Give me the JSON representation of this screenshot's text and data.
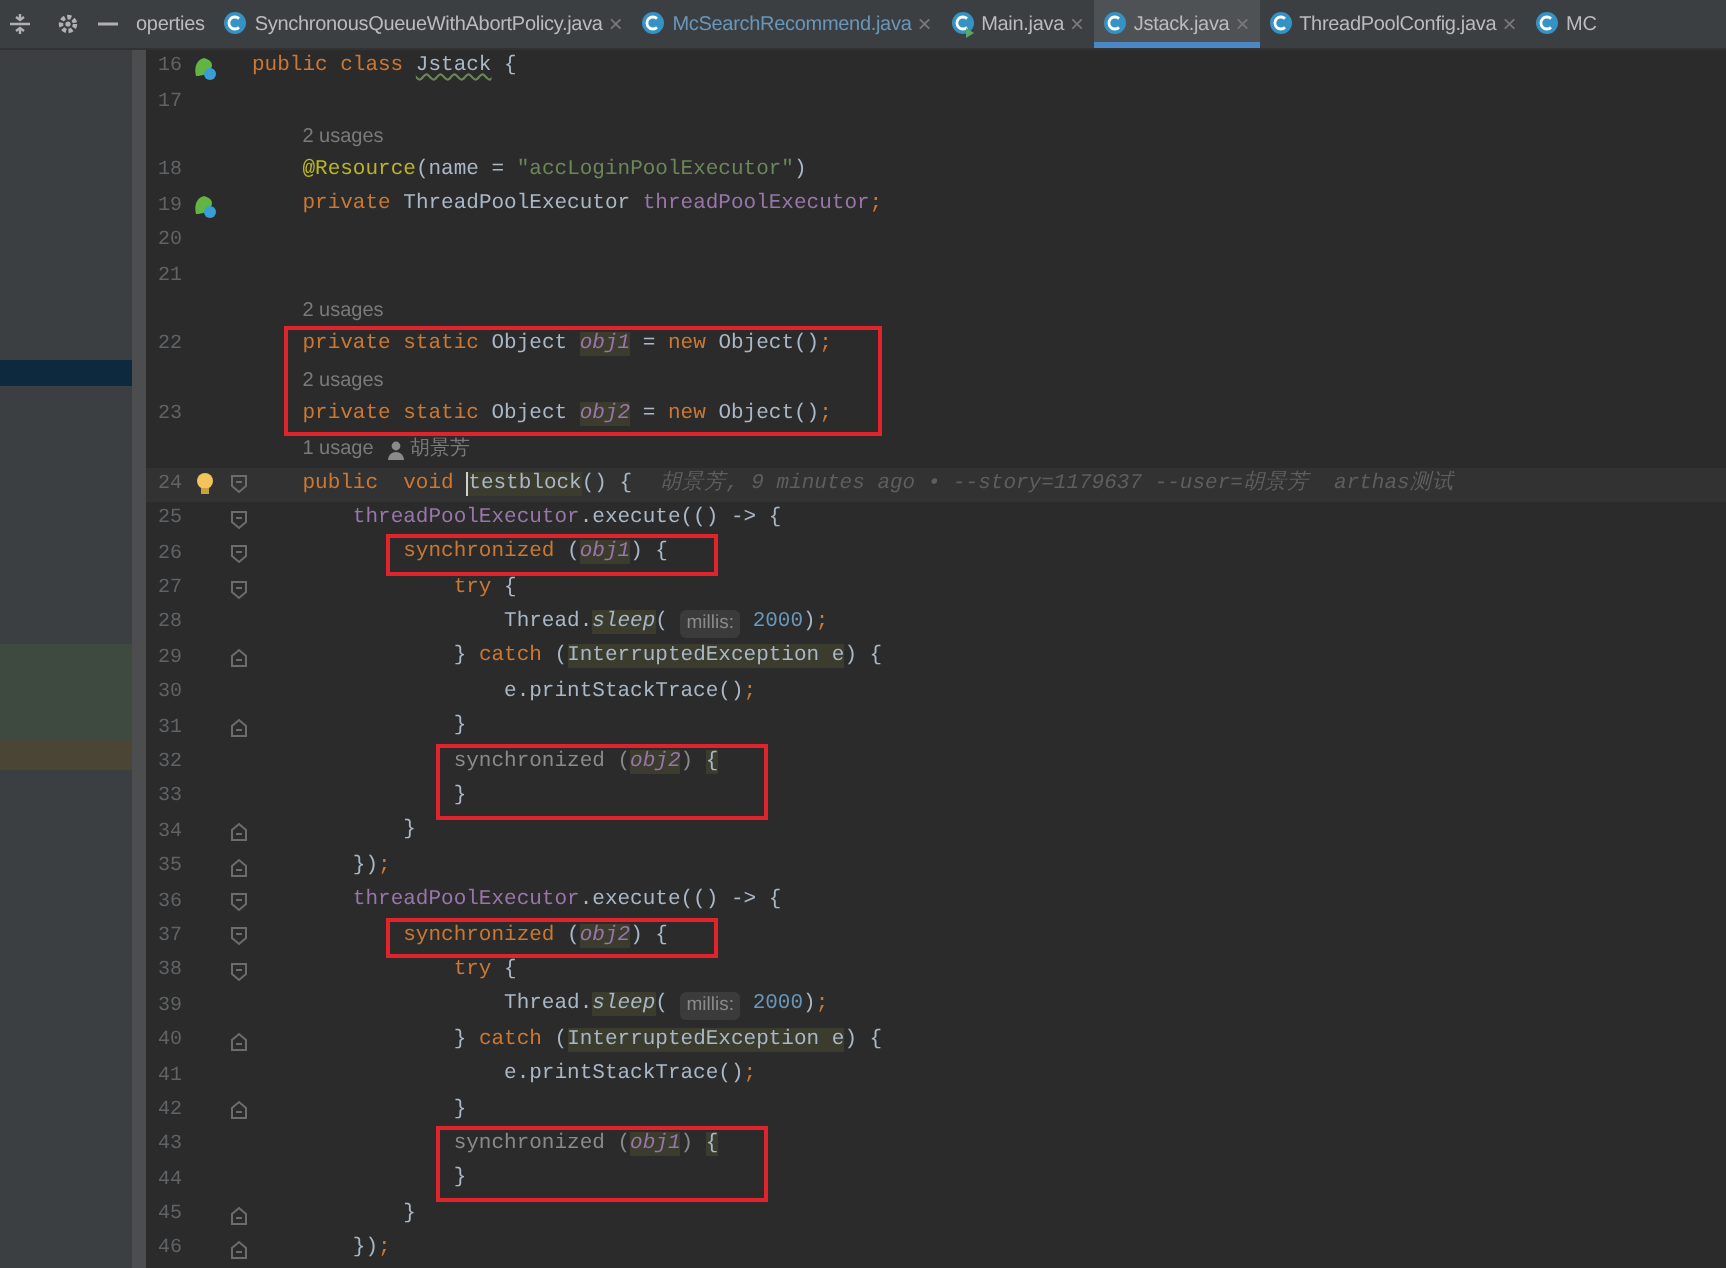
{
  "tabs": [
    {
      "label": "operties",
      "kind": "cut",
      "closable": false,
      "selected": false,
      "vcs_changed": false
    },
    {
      "label": "SynchronousQueueWithAbortPolicy.java",
      "kind": "class",
      "closable": true,
      "selected": false,
      "vcs_changed": false
    },
    {
      "label": "McSearchRecommend.java",
      "kind": "class",
      "closable": true,
      "selected": false,
      "vcs_changed": true
    },
    {
      "label": "Main.java",
      "kind": "runnable",
      "closable": true,
      "selected": false,
      "vcs_changed": false
    },
    {
      "label": "Jstack.java",
      "kind": "class",
      "closable": true,
      "selected": true,
      "vcs_changed": false
    },
    {
      "label": "ThreadPoolConfig.java",
      "kind": "class",
      "closable": true,
      "selected": false,
      "vcs_changed": false
    },
    {
      "label": "MC",
      "kind": "class",
      "closable": false,
      "selected": false,
      "vcs_changed": false
    }
  ],
  "close_glyph": "×",
  "editor": {
    "lines": [
      {
        "kind": "code",
        "number": "16",
        "bean_marker": true,
        "tokens": [
          {
            "kind": "kw",
            "text": "public class "
          },
          {
            "kind": "plain",
            "text": "Jstack",
            "squiggle": true
          },
          {
            "kind": "plain",
            "text": " {"
          }
        ]
      },
      {
        "kind": "code",
        "number": "17"
      },
      {
        "kind": "usage",
        "text": "    2 usages"
      },
      {
        "kind": "code",
        "number": "18",
        "tokens": [
          {
            "kind": "ann",
            "text": "    @Resource"
          },
          {
            "kind": "plain",
            "text": "(name = "
          },
          {
            "kind": "str",
            "text": "\"accLoginPoolExecutor\""
          },
          {
            "kind": "plain",
            "text": ")"
          }
        ]
      },
      {
        "kind": "code",
        "number": "19",
        "bean_marker": true,
        "tokens": [
          {
            "kind": "kw",
            "text": "    private "
          },
          {
            "kind": "plain",
            "text": "ThreadPoolExecutor "
          },
          {
            "kind": "field",
            "text": "threadPoolExecutor"
          },
          {
            "kind": "kw",
            "text": ";"
          }
        ]
      },
      {
        "kind": "code",
        "number": "20"
      },
      {
        "kind": "code",
        "number": "21"
      },
      {
        "kind": "usage",
        "text": "    2 usages"
      },
      {
        "kind": "boxed",
        "lines": [
          {
            "kind": "code",
            "number": "22",
            "tokens": [
              {
                "kind": "kw",
                "text": "    private static "
              },
              {
                "kind": "plain",
                "text": "Object "
              },
              {
                "kind": "sfield",
                "text": "obj1",
                "hl": true
              },
              {
                "kind": "plain",
                "text": " = "
              },
              {
                "kind": "kw",
                "text": "new "
              },
              {
                "kind": "plain",
                "text": "Object()"
              },
              {
                "kind": "kw",
                "text": ";"
              }
            ]
          },
          {
            "kind": "usage",
            "text": "    2 usages"
          },
          {
            "kind": "code",
            "number": "23",
            "tokens": [
              {
                "kind": "kw",
                "text": "    private static "
              },
              {
                "kind": "plain",
                "text": "Object "
              },
              {
                "kind": "sfield",
                "text": "obj2",
                "hl": true
              },
              {
                "kind": "plain",
                "text": " = "
              },
              {
                "kind": "kw",
                "text": "new "
              },
              {
                "kind": "plain",
                "text": "Object()"
              },
              {
                "kind": "kw",
                "text": ";"
              }
            ]
          }
        ]
      },
      {
        "kind": "usage",
        "text": "    1 usage",
        "author": "胡景芳"
      },
      {
        "kind": "code",
        "number": "24",
        "current": true,
        "intention_bulb": true,
        "fold_start": true,
        "tokens": [
          {
            "kind": "kw",
            "text": "    public  void "
          },
          {
            "kind": "plain",
            "text": "testblock",
            "hl": true,
            "caret": true
          },
          {
            "kind": "plain",
            "text": "() {"
          }
        ],
        "blame": "胡景芳, 9 minutes ago • --story=1179637 --user=胡景芳  arthas测试"
      },
      {
        "kind": "code",
        "number": "25",
        "fold_start": true,
        "tokens": [
          {
            "kind": "field",
            "text": "        threadPoolExecutor"
          },
          {
            "kind": "plain",
            "text": ".execute(() -> {"
          }
        ]
      },
      {
        "kind": "boxed",
        "lines": [
          {
            "kind": "code",
            "number": "26",
            "fold_start": true,
            "tokens": [
              {
                "kind": "kw",
                "text": "            synchronized "
              },
              {
                "kind": "plain",
                "text": "("
              },
              {
                "kind": "sfield",
                "text": "obj1",
                "hl": true
              },
              {
                "kind": "plain",
                "text": ") {"
              }
            ]
          }
        ]
      },
      {
        "kind": "code",
        "number": "27",
        "fold_start": true,
        "tokens": [
          {
            "kind": "kw",
            "text": "                try "
          },
          {
            "kind": "plain",
            "text": "{"
          }
        ]
      },
      {
        "kind": "code",
        "number": "28",
        "tokens": [
          {
            "kind": "plain",
            "text": "                    Thread."
          },
          {
            "kind": "static",
            "text": "sleep",
            "hl": true
          },
          {
            "kind": "plain",
            "text": "( "
          },
          {
            "kind": "hint",
            "text": "millis:"
          },
          {
            "kind": "num",
            "text": " 2000"
          },
          {
            "kind": "plain",
            "text": ")"
          },
          {
            "kind": "kw",
            "text": ";"
          }
        ]
      },
      {
        "kind": "code",
        "number": "29",
        "fold_end": true,
        "tokens": [
          {
            "kind": "plain",
            "text": "                } "
          },
          {
            "kind": "kw",
            "text": "catch "
          },
          {
            "kind": "plain",
            "text": "("
          },
          {
            "kind": "plain",
            "text": "InterruptedException e",
            "hl": true
          },
          {
            "kind": "plain",
            "text": ") {"
          }
        ]
      },
      {
        "kind": "code",
        "number": "30",
        "tokens": [
          {
            "kind": "plain",
            "text": "                    e.printStackTrace()"
          },
          {
            "kind": "kw",
            "text": ";"
          }
        ]
      },
      {
        "kind": "code",
        "number": "31",
        "fold_end": true,
        "tokens": [
          {
            "kind": "plain",
            "text": "                }"
          }
        ]
      },
      {
        "kind": "boxed",
        "lines": [
          {
            "kind": "code",
            "number": "32",
            "tokens": [
              {
                "kind": "dim",
                "text": "                synchronized ("
              },
              {
                "kind": "sfield",
                "text": "obj2",
                "hl": true
              },
              {
                "kind": "dim",
                "text": ") "
              },
              {
                "kind": "plain",
                "text": "{",
                "hl": true
              }
            ]
          },
          {
            "kind": "code",
            "number": "33",
            "tokens": [
              {
                "kind": "plain",
                "text": "                }"
              }
            ]
          }
        ]
      },
      {
        "kind": "code",
        "number": "34",
        "fold_end": true,
        "tokens": [
          {
            "kind": "plain",
            "text": "            }"
          }
        ]
      },
      {
        "kind": "code",
        "number": "35",
        "fold_end": true,
        "tokens": [
          {
            "kind": "plain",
            "text": "        })"
          },
          {
            "kind": "kw",
            "text": ";"
          }
        ]
      },
      {
        "kind": "code",
        "number": "36",
        "fold_start": true,
        "tokens": [
          {
            "kind": "field",
            "text": "        threadPoolExecutor"
          },
          {
            "kind": "plain",
            "text": ".execute(() -> {"
          }
        ]
      },
      {
        "kind": "boxed",
        "lines": [
          {
            "kind": "code",
            "number": "37",
            "fold_start": true,
            "tokens": [
              {
                "kind": "kw",
                "text": "            synchronized "
              },
              {
                "kind": "plain",
                "text": "("
              },
              {
                "kind": "sfield",
                "text": "obj2",
                "hl": true
              },
              {
                "kind": "plain",
                "text": ") {"
              }
            ]
          }
        ]
      },
      {
        "kind": "code",
        "number": "38",
        "fold_start": true,
        "tokens": [
          {
            "kind": "kw",
            "text": "                try "
          },
          {
            "kind": "plain",
            "text": "{"
          }
        ]
      },
      {
        "kind": "code",
        "number": "39",
        "tokens": [
          {
            "kind": "plain",
            "text": "                    Thread."
          },
          {
            "kind": "static",
            "text": "sleep",
            "hl": true
          },
          {
            "kind": "plain",
            "text": "( "
          },
          {
            "kind": "hint",
            "text": "millis:"
          },
          {
            "kind": "num",
            "text": " 2000"
          },
          {
            "kind": "plain",
            "text": ")"
          },
          {
            "kind": "kw",
            "text": ";"
          }
        ]
      },
      {
        "kind": "code",
        "number": "40",
        "fold_end": true,
        "tokens": [
          {
            "kind": "plain",
            "text": "                } "
          },
          {
            "kind": "kw",
            "text": "catch "
          },
          {
            "kind": "plain",
            "text": "("
          },
          {
            "kind": "plain",
            "text": "InterruptedException e",
            "hl": true
          },
          {
            "kind": "plain",
            "text": ") {"
          }
        ]
      },
      {
        "kind": "code",
        "number": "41",
        "tokens": [
          {
            "kind": "plain",
            "text": "                    e.printStackTrace()"
          },
          {
            "kind": "kw",
            "text": ";"
          }
        ]
      },
      {
        "kind": "code",
        "number": "42",
        "fold_end": true,
        "tokens": [
          {
            "kind": "plain",
            "text": "                }"
          }
        ]
      },
      {
        "kind": "boxed",
        "lines": [
          {
            "kind": "code",
            "number": "43",
            "tokens": [
              {
                "kind": "dim",
                "text": "                synchronized ("
              },
              {
                "kind": "sfield",
                "text": "obj1",
                "hl": true
              },
              {
                "kind": "dim",
                "text": ") "
              },
              {
                "kind": "plain",
                "text": "{",
                "hl": true
              }
            ]
          },
          {
            "kind": "code",
            "number": "44",
            "tokens": [
              {
                "kind": "plain",
                "text": "                }"
              }
            ]
          }
        ]
      },
      {
        "kind": "code",
        "number": "45",
        "fold_end": true,
        "tokens": [
          {
            "kind": "plain",
            "text": "            }"
          }
        ]
      },
      {
        "kind": "code",
        "number": "46",
        "fold_end": true,
        "tokens": [
          {
            "kind": "plain",
            "text": "        })"
          },
          {
            "kind": "kw",
            "text": ";"
          }
        ]
      }
    ]
  }
}
